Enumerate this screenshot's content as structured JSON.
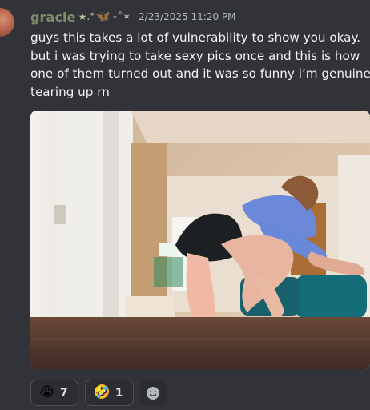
{
  "message": {
    "author": "gracie",
    "flair": {
      "prefix": "★.°",
      "suffix": "⋆˚✶"
    },
    "timestamp": "2/23/2025 11:20 PM",
    "text_lines": [
      "guys this takes a lot of vulnerability to show you okay.",
      "but i was trying to take sexy pics once and this is how",
      "one of them turned out and it was so funny i’m genuine",
      "tearing up rn"
    ],
    "attachment": {
      "type": "image"
    },
    "reactions": [
      {
        "emoji": "😭",
        "count": "7"
      },
      {
        "emoji": "🤣",
        "count": "1"
      }
    ]
  },
  "icons": {
    "butterfly": "butterfly-icon",
    "add_reaction": "add-reaction-icon"
  },
  "colors": {
    "background": "#313338",
    "username": "#7f8b69",
    "timestamp": "#b5bac1",
    "message_text": "#f2f3f5",
    "reaction_background": "#2b2d31",
    "reaction_border": "#4e5058"
  }
}
